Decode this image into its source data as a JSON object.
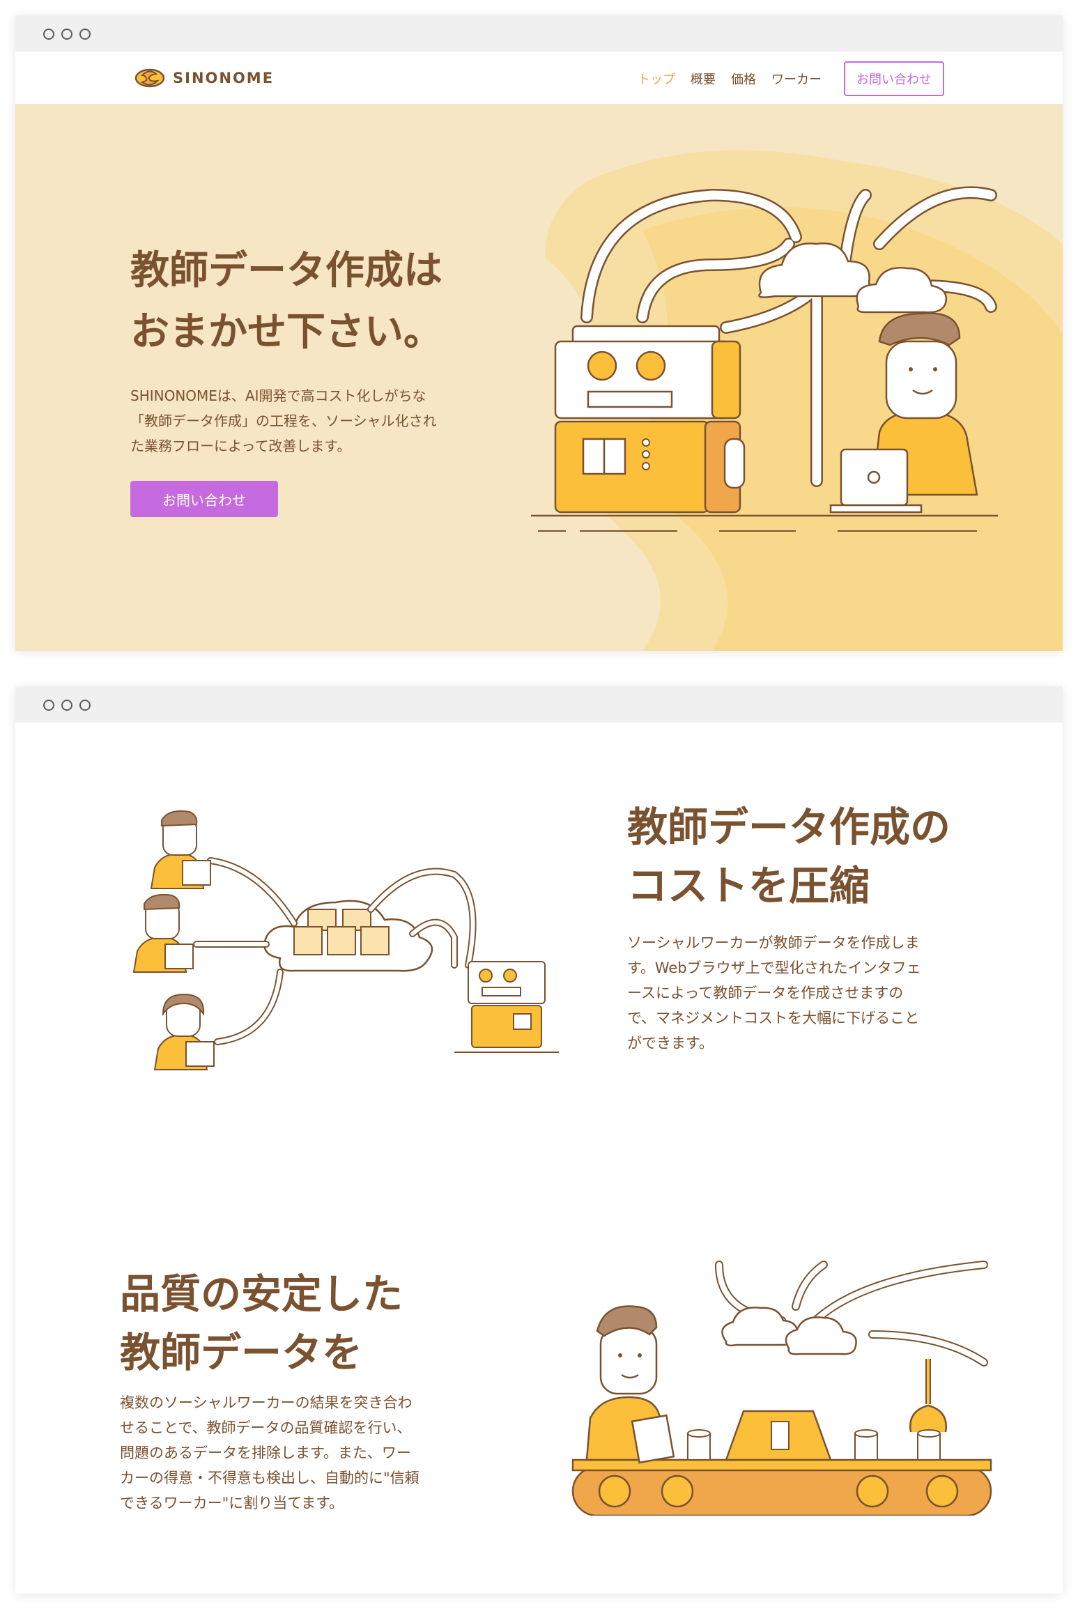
{
  "brand": {
    "name": "SINONOME"
  },
  "nav": {
    "items": [
      "トップ",
      "概要",
      "価格",
      "ワーカー"
    ],
    "active_index": 0,
    "cta": "お問い合わせ"
  },
  "hero": {
    "title_line1": "教師データ作成は",
    "title_line2": "おまかせ下さい。",
    "description_line1": "SHINONOMEは、AI開発で高コスト化しがちな",
    "description_line2": "「教師データ作成」の工程を、ソーシャル化され",
    "description_line3": "た業務フローによって改善します。",
    "button": "お問い合わせ"
  },
  "features": [
    {
      "title_line1": "教師データ作成の",
      "title_line2": "コストを圧縮",
      "description_lines": [
        "ソーシャルワーカーが教師データを作成しま",
        "す。Webブラウザ上で型化されたインタフェ",
        "ースによって教師データを作成させますの",
        "で、マネジメントコストを大幅に下げること",
        "ができます。"
      ]
    },
    {
      "title_line1": "品質の安定した",
      "title_line2": "教師データを",
      "description_lines": [
        "複数のソーシャルワーカーの結果を突き合わ",
        "せることで、教師データの品質確認を行い、",
        "問題のあるデータを排除します。また、ワー",
        "カーの得意・不得意も検出し、自動的に\"信頼",
        "できるワーカー\"に割り当てます。"
      ]
    }
  ],
  "colors": {
    "brown": "#7a5230",
    "orange": "#f0a64b",
    "yellow": "#fbbf3a",
    "purple": "#c66ae0",
    "hero_bg": "#f6e6c4"
  },
  "icons": [
    "logo-mark-icon",
    "browser-dot-icon"
  ]
}
